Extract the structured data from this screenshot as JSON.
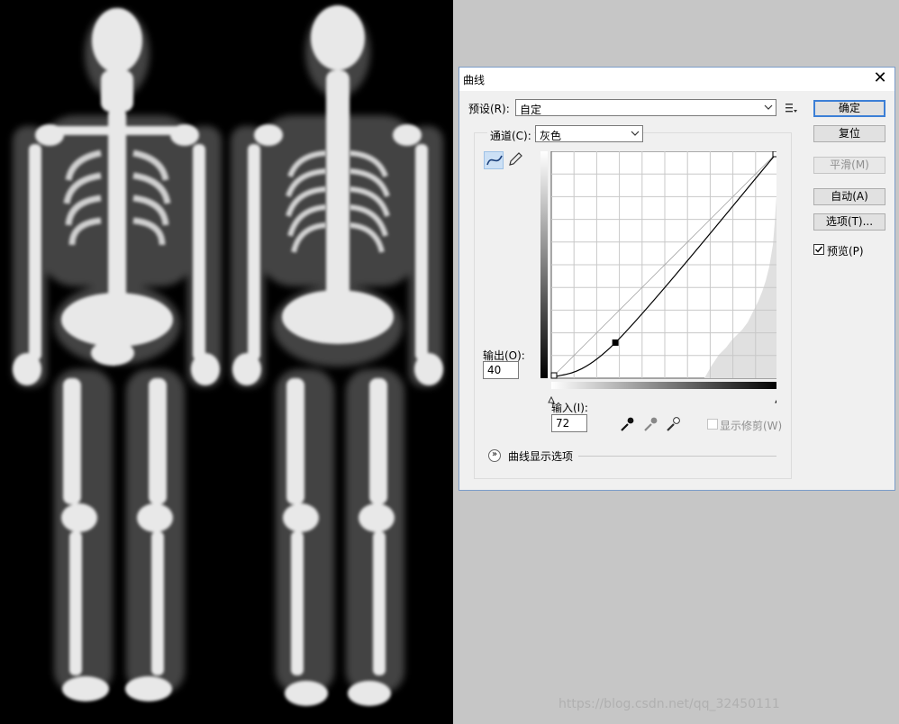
{
  "dialog": {
    "title": "曲线",
    "preset_label": "预设(R):",
    "preset_value": "自定",
    "channel_label": "通道(C):",
    "channel_value": "灰色",
    "output_label": "输出(O):",
    "output_value": "40",
    "input_label": "输入(I):",
    "input_value": "72",
    "show_clipping_label": "显示修剪(W)",
    "display_options_label": "曲线显示选项",
    "buttons": {
      "ok": "确定",
      "reset": "复位",
      "smooth": "平滑(M)",
      "auto": "自动(A)",
      "options": "选项(T)..."
    },
    "preview_label": "预览(P)",
    "preview_checked": true
  },
  "watermark": "https://blog.csdn.net/qq_32450111",
  "colors": {
    "accent": "#3c7fd6",
    "active_tool": "#cce0f5"
  },
  "curve_data": {
    "type": "line",
    "x_range": [
      0,
      255
    ],
    "y_range": [
      0,
      255
    ],
    "points": [
      [
        0,
        0
      ],
      [
        72,
        40
      ],
      [
        255,
        255
      ]
    ],
    "grid_divisions": 10
  }
}
